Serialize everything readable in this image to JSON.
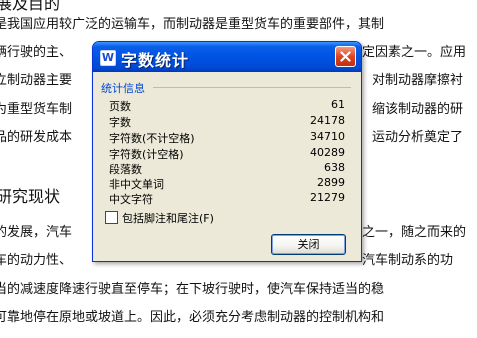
{
  "document": {
    "lines": [
      "展及目的",
      "是我国应用较广泛的运输车，而制动器是重型货车的重要部件，其制",
      "辆行驶的主、",
      "定因素之一。应用",
      "立制动器主要",
      "对制动器摩擦衬",
      "为重型货车制",
      "缩该制动器的研",
      "品的研发成本",
      "运动分析奠定了",
      "研究现状",
      "的发展，汽车",
      "之一，随之而来的",
      "车的动力性、",
      "汽车制动系的功",
      "当的减速度降速行驶直至停车；在下坡行驶时，使汽车保持适当的稳",
      "可靠地停在原地或坡道上。因此，必须充分考虑制动器的控制机构和"
    ]
  },
  "dialog": {
    "title": "字数统计",
    "title_icon": "W",
    "group_label": "统计信息",
    "stats": [
      {
        "label": "页数",
        "value": "61"
      },
      {
        "label": "字数",
        "value": "24178"
      },
      {
        "label": "字符数(不计空格)",
        "value": "34710"
      },
      {
        "label": "字符数(计空格)",
        "value": "40289"
      },
      {
        "label": "段落数",
        "value": "638"
      },
      {
        "label": "非中文单词",
        "value": "2899"
      },
      {
        "label": "中文字符",
        "value": "21279"
      }
    ],
    "checkbox_label": "包括脚注和尾注(F)",
    "checkbox_checked": false,
    "close_button": "关闭",
    "icons": {
      "title": "word-app-icon",
      "close": "close-icon"
    },
    "colors": {
      "titlebar": "#0054e3",
      "body": "#ece9d8",
      "group_label": "#0046d5",
      "close": "#e0431f"
    }
  }
}
